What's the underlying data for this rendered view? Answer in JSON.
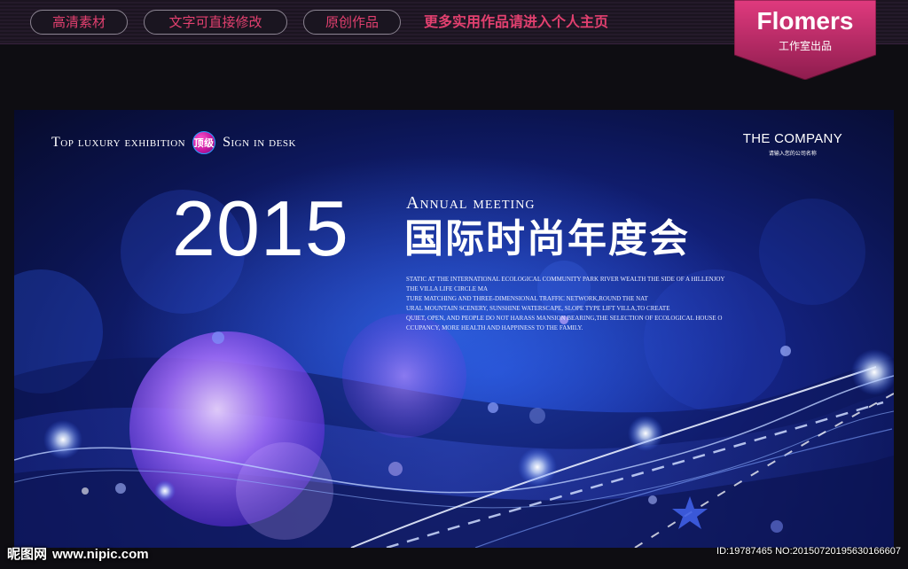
{
  "toolbar": {
    "buttons": [
      "高清素材",
      "文字可直接修改",
      "原创作品"
    ],
    "link": "更多实用作品请进入个人主页"
  },
  "brand": {
    "name": "Flomers",
    "sub": "工作室出品",
    "color": "#c4306e"
  },
  "banner": {
    "tagline_left": "Top luxury exhibition",
    "badge": "顶级",
    "tagline_right": "Sign in desk",
    "company_name": "THE COMPANY",
    "company_sub": "请输入您的公司名称",
    "year": "2015",
    "annual": "Annual meeting",
    "title_cn": "国际时尚年度会",
    "description": [
      "STATIC AT THE INTERNATIONAL ECOLOGICAL COMMUNITY PARK RIVER WEALTH THE SIDE OF A HILLENJOY",
      "THE VILLA LIFE CIRCLE MA",
      "TURE MATCHING AND THREE-DIMENSIONAL TRAFFIC NETWORK,ROUND THE NAT",
      "URAL MOUNTAIN SCENERY, SUNSHINE WATERSCAPE, SLOPE TYPE LIFT VILLA,TO CREATE",
      "QUIET, OPEN, AND PEOPLE DO NOT HARASS MANSION BEARING,THE SELECTION OF ECOLOGICAL HOUSE O",
      "CCUPANCY, MORE HEALTH AND HAPPINESS TO THE FAMILY."
    ],
    "colors": {
      "deep": "#070b2c",
      "mid": "#15258a",
      "glow": "#2a6bff",
      "violet": "#9a6bff"
    }
  },
  "watermark": {
    "site": "昵图网",
    "url": "www.nipic.com",
    "id_text": "ID:19787465 NO:20150720195630166607"
  }
}
